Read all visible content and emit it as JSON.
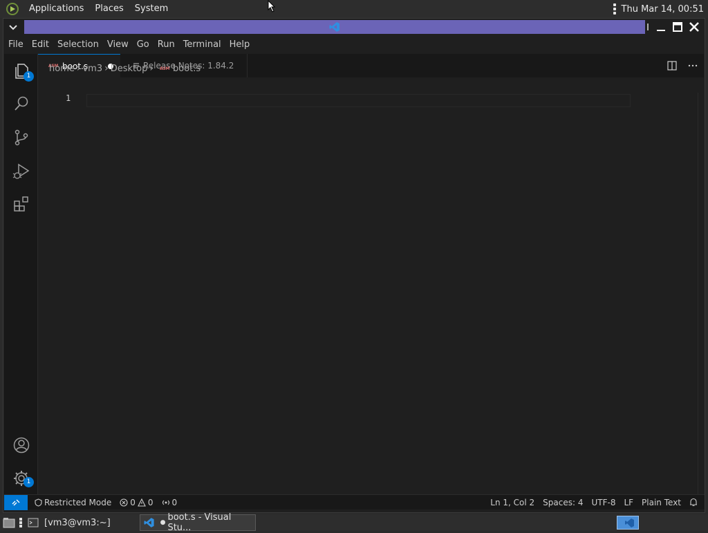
{
  "system_panel": {
    "menus": [
      "Applications",
      "Places",
      "System"
    ],
    "clock": "Thu Mar 14, 00:51"
  },
  "window": {
    "accent_color": "#6b64b7"
  },
  "menubar": {
    "items": [
      "File",
      "Edit",
      "Selection",
      "View",
      "Go",
      "Run",
      "Terminal",
      "Help"
    ]
  },
  "activity_bar": {
    "items": [
      {
        "icon": "explorer-icon",
        "badge": "1"
      },
      {
        "icon": "search-icon"
      },
      {
        "icon": "source-control-icon"
      },
      {
        "icon": "run-debug-icon"
      },
      {
        "icon": "extensions-icon"
      }
    ],
    "bottom": [
      {
        "icon": "accounts-icon"
      },
      {
        "icon": "manage-gear-icon",
        "badge": "1"
      }
    ]
  },
  "tabs": [
    {
      "file_type": "ASM",
      "label": "boot.s",
      "modified": true,
      "active": true
    },
    {
      "label": "Release Notes: 1.84.2",
      "active": false
    }
  ],
  "breadcrumb": [
    "home",
    "vm3",
    "Desktop",
    "boot.s"
  ],
  "breadcrumb_file_type": "ASM",
  "editor": {
    "line_numbers": [
      "1"
    ],
    "content": ""
  },
  "statusbar": {
    "restricted": "Restricted Mode",
    "errors": "0",
    "warnings": "0",
    "ports": "0",
    "position": "Ln 1, Col 2",
    "spaces": "Spaces: 4",
    "encoding": "UTF-8",
    "eol": "LF",
    "language": "Plain Text",
    "remote_color": "#0078d4"
  },
  "taskbar": {
    "tasks": [
      {
        "label": "[vm3@vm3:~]",
        "active": false
      },
      {
        "label": "boot.s - Visual Stu...",
        "active": true
      }
    ]
  }
}
